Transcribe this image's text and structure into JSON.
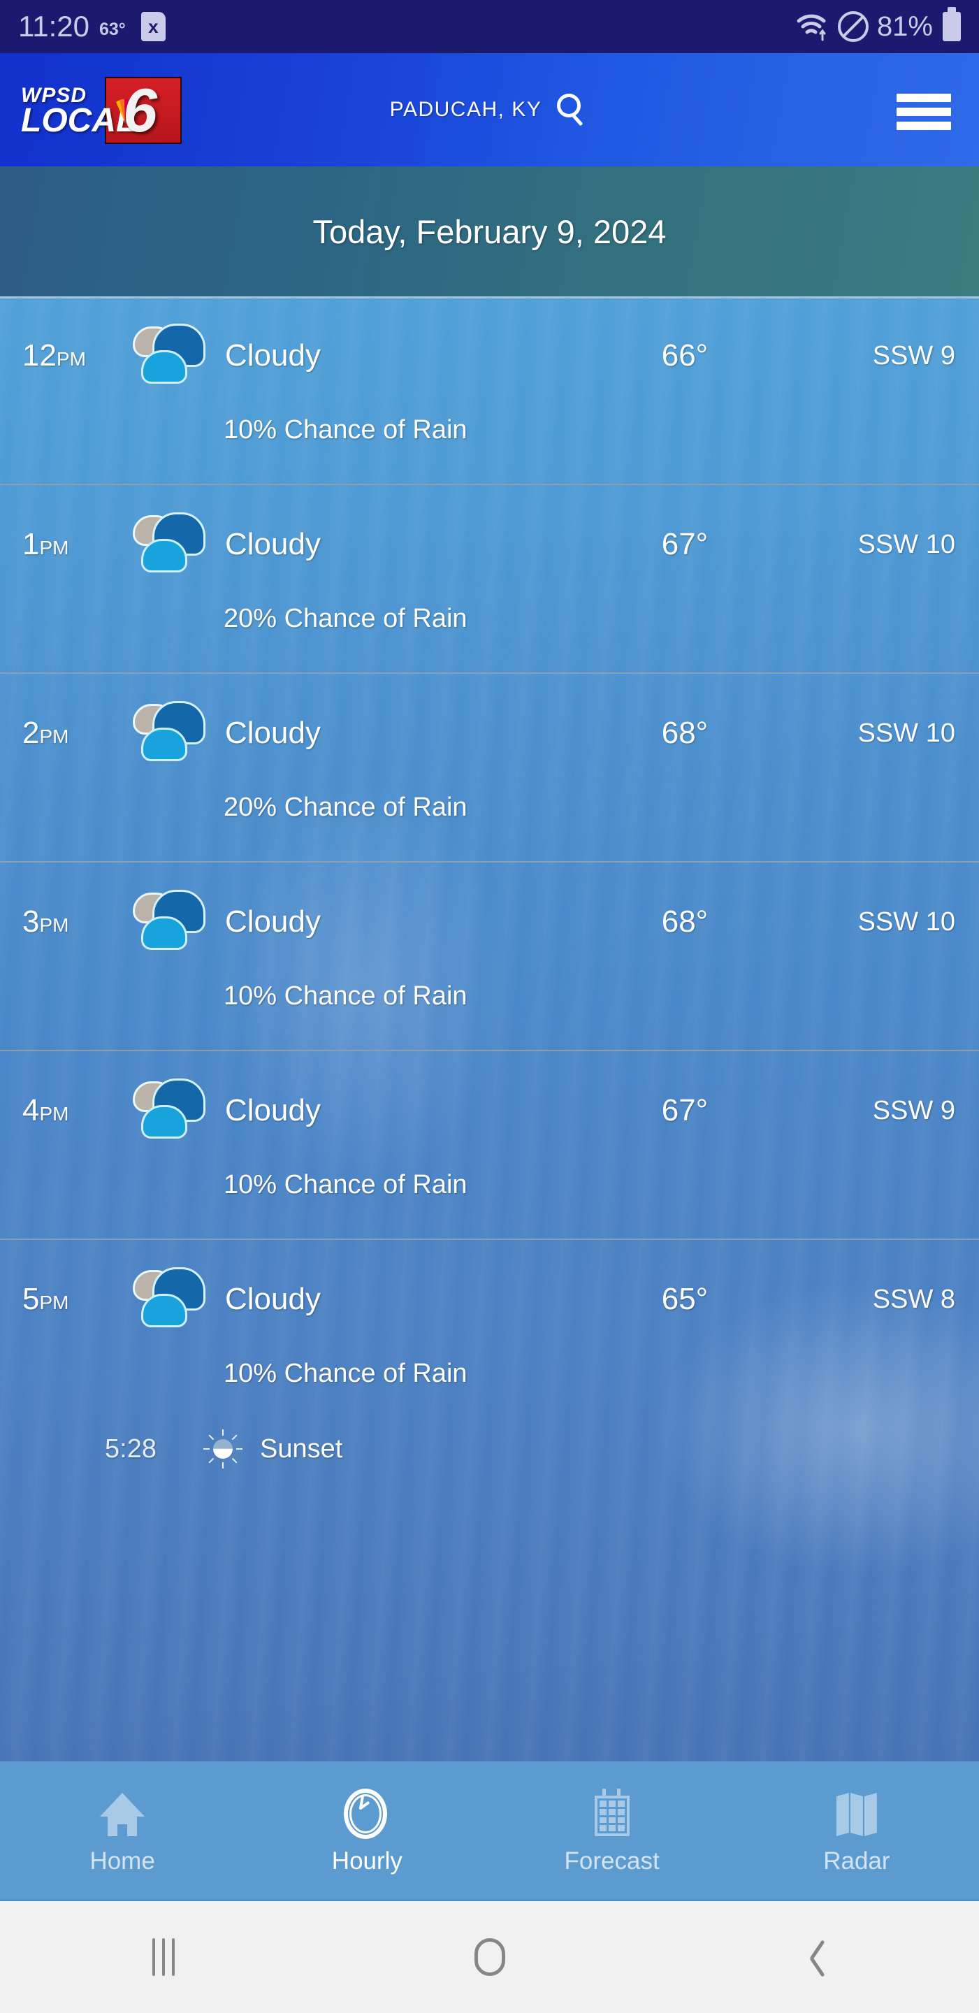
{
  "status_bar": {
    "time": "11:20",
    "temperature": "63°",
    "sim_icon_label": "x",
    "battery_percent": "81%",
    "icons": [
      "wifi-icon",
      "do-not-disturb-icon",
      "battery-icon",
      "sim-card-icon"
    ]
  },
  "app_header": {
    "logo_line1": "WPSD",
    "logo_line2": "LOCAL",
    "logo_channel": "6",
    "location": "PADUCAH, KY",
    "search_icon": "search-icon",
    "menu_icon": "hamburger-menu-icon"
  },
  "date_banner": {
    "title": "Today, February 9, 2024"
  },
  "hourly": {
    "rows": [
      {
        "time": "12",
        "ampm": "PM",
        "condition": "Cloudy",
        "temp": "66°",
        "wind": "SSW 9",
        "rain": "10% Chance of Rain",
        "icon": "cloudy-icon"
      },
      {
        "time": "1",
        "ampm": "PM",
        "condition": "Cloudy",
        "temp": "67°",
        "wind": "SSW 10",
        "rain": "20% Chance of Rain",
        "icon": "cloudy-icon"
      },
      {
        "time": "2",
        "ampm": "PM",
        "condition": "Cloudy",
        "temp": "68°",
        "wind": "SSW 10",
        "rain": "20% Chance of Rain",
        "icon": "cloudy-icon"
      },
      {
        "time": "3",
        "ampm": "PM",
        "condition": "Cloudy",
        "temp": "68°",
        "wind": "SSW 10",
        "rain": "10% Chance of Rain",
        "icon": "cloudy-icon"
      },
      {
        "time": "4",
        "ampm": "PM",
        "condition": "Cloudy",
        "temp": "67°",
        "wind": "SSW 9",
        "rain": "10% Chance of Rain",
        "icon": "cloudy-icon"
      },
      {
        "time": "5",
        "ampm": "PM",
        "condition": "Cloudy",
        "temp": "65°",
        "wind": "SSW 8",
        "rain": "10% Chance of Rain",
        "icon": "cloudy-icon"
      }
    ],
    "sunset": {
      "time": "5:28",
      "label": "Sunset",
      "icon": "sunset-sun-icon"
    }
  },
  "tabbar": {
    "items": [
      {
        "label": "Home",
        "icon": "home-icon",
        "active": false
      },
      {
        "label": "Hourly",
        "icon": "clock-icon",
        "active": true
      },
      {
        "label": "Forecast",
        "icon": "calendar-icon",
        "active": false
      },
      {
        "label": "Radar",
        "icon": "map-icon",
        "active": false
      }
    ]
  },
  "android_nav": {
    "recents_label": "recents-icon",
    "home_label": "home-icon",
    "back_label": "back-icon"
  },
  "colors": {
    "status_bar_bg": "#1b1a6e",
    "header_blue": "#1a44d8",
    "date_banner": "#33707f",
    "list_blue": "#4a86c8",
    "tabbar_blue": "#5b9bd0",
    "accent_white": "#ffffff",
    "nbc_red": "#d61f26"
  }
}
